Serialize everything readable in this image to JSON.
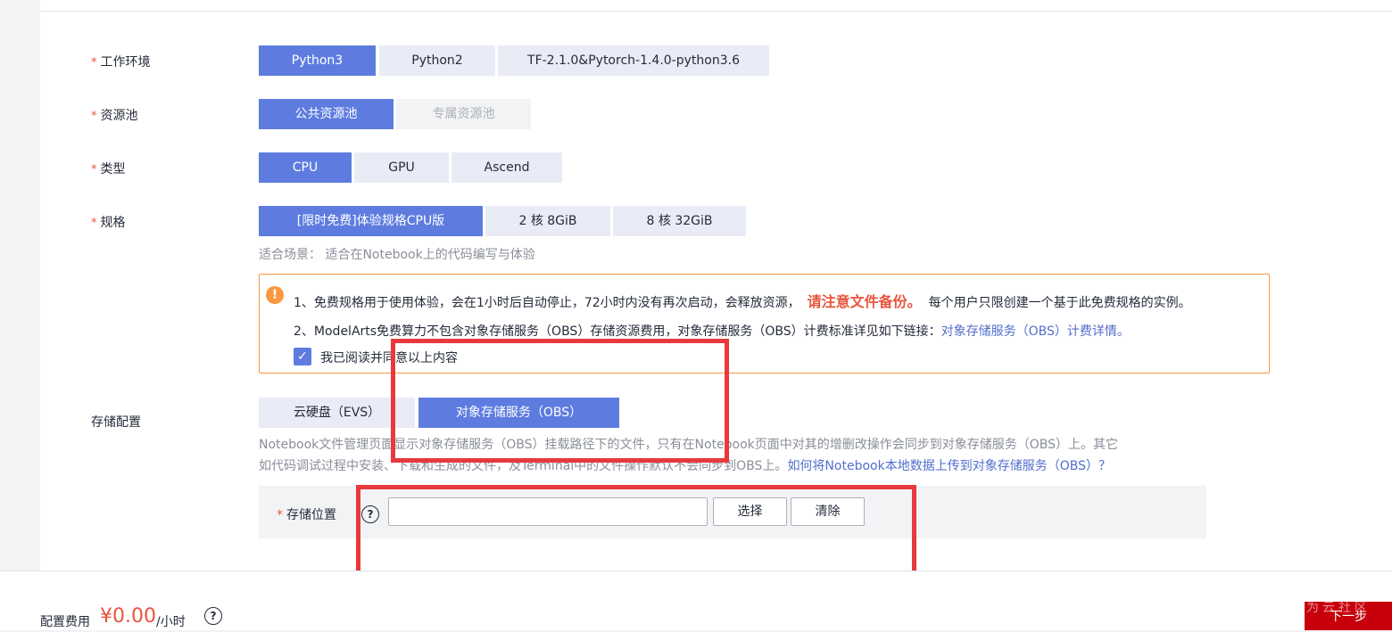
{
  "env": {
    "label": "工作环境",
    "options": [
      "Python3",
      "Python2",
      "TF-2.1.0&Pytorch-1.4.0-python3.6"
    ],
    "selected": "Python3"
  },
  "pool": {
    "label": "资源池",
    "options": [
      "公共资源池",
      "专属资源池"
    ],
    "selected": "公共资源池",
    "disabled": "专属资源池"
  },
  "type": {
    "label": "类型",
    "options": [
      "CPU",
      "GPU",
      "Ascend"
    ],
    "selected": "CPU"
  },
  "spec": {
    "label": "规格",
    "options": [
      "[限时免费]体验规格CPU版",
      "2 核 8GiB",
      "8 核 32GiB"
    ],
    "selected": "[限时免费]体验规格CPU版",
    "scenario": "适合场景：  适合在Notebook上的代码编写与体验"
  },
  "notice": {
    "line1_prefix": "1、免费规格用于使用体验，会在1小时后自动停止，72小时内没有再次启动，会释放资源，",
    "line1_emphasis": "请注意文件备份。",
    "line1_suffix": "每个用户只限创建一个基于此免费规格的实例。",
    "line2_prefix": "2、ModelArts免费算力不包含对象存储服务（OBS）存储资源费用，对象存储服务（OBS）计费标准详见如下链接：",
    "line2_link": "对象存储服务（OBS）计费详情。",
    "agree_label": "我已阅读并同意以上内容",
    "agree_checked": true
  },
  "storage": {
    "label": "存储配置",
    "options": [
      "云硬盘（EVS）",
      "对象存储服务（OBS）"
    ],
    "selected": "对象存储服务（OBS）",
    "desc_line1": "Notebook文件管理页面显示对象存储服务（OBS）挂载路径下的文件，只有在Notebook页面中对其的增删改操作会同步到对象存储服务（OBS）上。其它",
    "desc_line2": "如代码调试过程中安装、下载和生成的文件，及Terminal中的文件操作默认不会同步到OBS上。",
    "desc_link": "如何将Notebook本地数据上传到对象存储服务（OBS）？",
    "location_label": "存储位置",
    "location_value": "",
    "select_button": "选择",
    "clear_button": "清除"
  },
  "footer": {
    "fee_label": "配置费用",
    "fee_value": "¥0.00",
    "fee_unit": "/小时",
    "next_button": "下一步",
    "watermark": "为云社区"
  },
  "colors": {
    "primary": "#5e7ce0",
    "required": "#e8553e",
    "warning": "#fa9841",
    "annotation": "#e8393d",
    "next_button": "#c7000b"
  }
}
